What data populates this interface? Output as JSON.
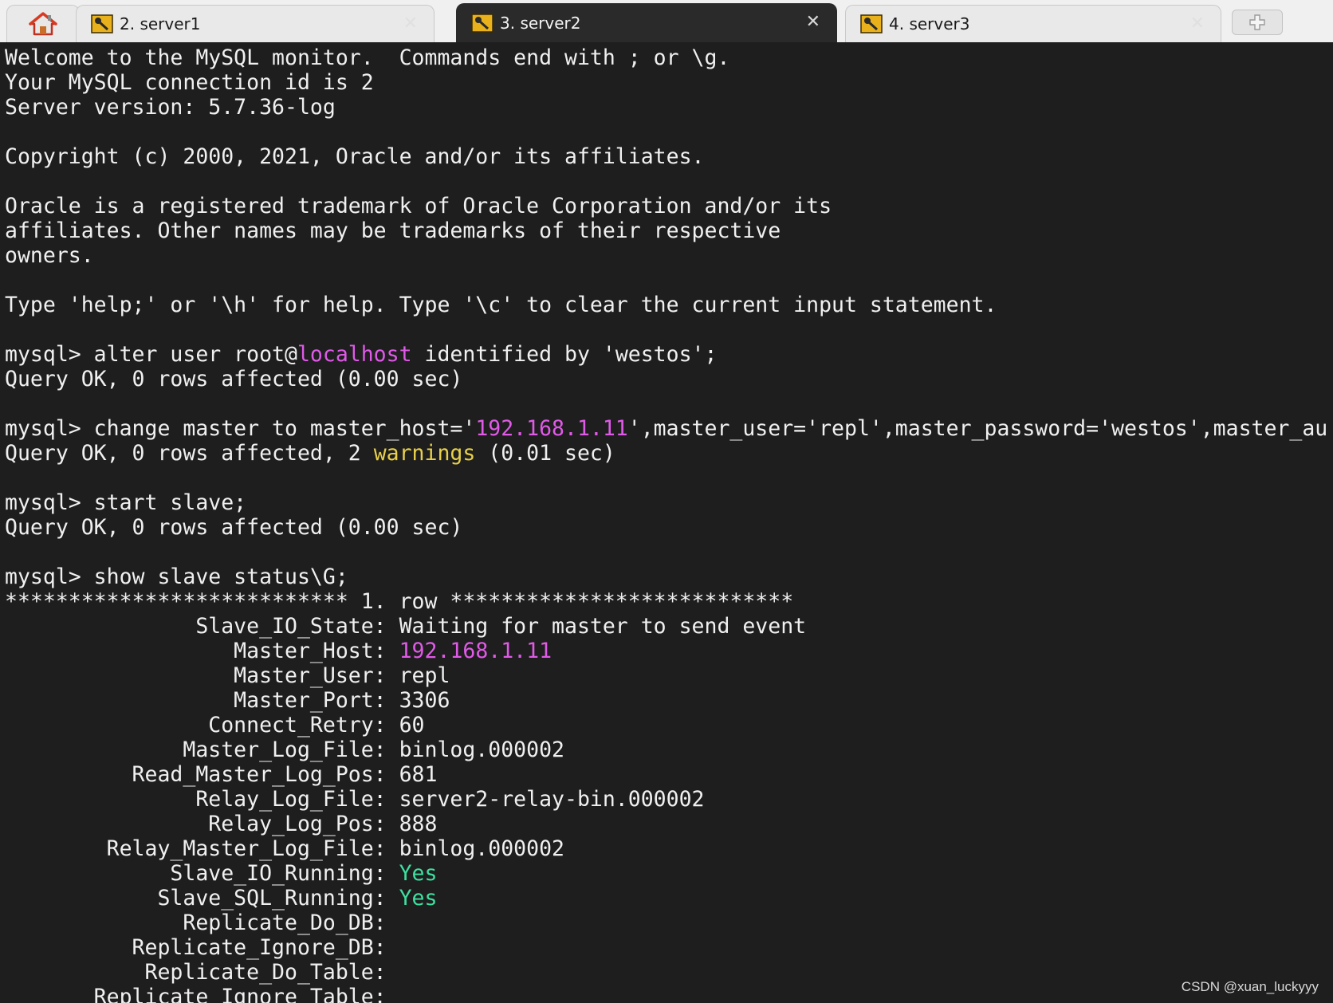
{
  "tabs": [
    {
      "label": "2. server1",
      "active": false
    },
    {
      "label": "3. server2",
      "active": true
    },
    {
      "label": "4. server3",
      "active": false
    }
  ],
  "terminal": {
    "lines": [
      [
        {
          "t": "Welcome to the MySQL monitor.  Commands end with ; or \\g."
        }
      ],
      [
        {
          "t": "Your MySQL connection id is 2"
        }
      ],
      [
        {
          "t": "Server version: 5.7.36-log"
        }
      ],
      [
        {
          "t": ""
        }
      ],
      [
        {
          "t": "Copyright (c) 2000, 2021, Oracle and/or its affiliates."
        }
      ],
      [
        {
          "t": ""
        }
      ],
      [
        {
          "t": "Oracle is a registered trademark of Oracle Corporation and/or its"
        }
      ],
      [
        {
          "t": "affiliates. Other names may be trademarks of their respective"
        }
      ],
      [
        {
          "t": "owners."
        }
      ],
      [
        {
          "t": ""
        }
      ],
      [
        {
          "t": "Type 'help;' or '\\h' for help. Type '\\c' to clear the current input statement."
        }
      ],
      [
        {
          "t": ""
        }
      ],
      [
        {
          "t": "mysql> alter user root@"
        },
        {
          "t": "localhost",
          "c": "magenta"
        },
        {
          "t": " identified by 'westos';"
        }
      ],
      [
        {
          "t": "Query OK, 0 rows affected (0.00 sec)"
        }
      ],
      [
        {
          "t": ""
        }
      ],
      [
        {
          "t": "mysql> change master to master_host='"
        },
        {
          "t": "192.168.1.11",
          "c": "magenta"
        },
        {
          "t": "',master_user='repl',master_password='westos',master_au"
        }
      ],
      [
        {
          "t": "Query OK, 0 rows affected, 2 "
        },
        {
          "t": "warnings",
          "c": "yellow"
        },
        {
          "t": " (0.01 sec)"
        }
      ],
      [
        {
          "t": ""
        }
      ],
      [
        {
          "t": "mysql> start slave;"
        }
      ],
      [
        {
          "t": "Query OK, 0 rows affected (0.00 sec)"
        }
      ],
      [
        {
          "t": ""
        }
      ],
      [
        {
          "t": "mysql> show slave status\\G;"
        }
      ],
      [
        {
          "t": "*************************** 1. row ***************************"
        }
      ],
      [
        {
          "t": "               Slave_IO_State: Waiting for master to send event"
        }
      ],
      [
        {
          "t": "                  Master_Host: "
        },
        {
          "t": "192.168.1.11",
          "c": "magenta"
        }
      ],
      [
        {
          "t": "                  Master_User: repl"
        }
      ],
      [
        {
          "t": "                  Master_Port: 3306"
        }
      ],
      [
        {
          "t": "                Connect_Retry: 60"
        }
      ],
      [
        {
          "t": "              Master_Log_File: binlog.000002"
        }
      ],
      [
        {
          "t": "          Read_Master_Log_Pos: 681"
        }
      ],
      [
        {
          "t": "               Relay_Log_File: server2-relay-bin.000002"
        }
      ],
      [
        {
          "t": "                Relay_Log_Pos: 888"
        }
      ],
      [
        {
          "t": "        Relay_Master_Log_File: binlog.000002"
        }
      ],
      [
        {
          "t": "             Slave_IO_Running: "
        },
        {
          "t": "Yes",
          "c": "green"
        }
      ],
      [
        {
          "t": "            Slave_SQL_Running: "
        },
        {
          "t": "Yes",
          "c": "green"
        }
      ],
      [
        {
          "t": "              Replicate_Do_DB:"
        }
      ],
      [
        {
          "t": "          Replicate_Ignore_DB:"
        }
      ],
      [
        {
          "t": "           Replicate_Do_Table:"
        }
      ],
      [
        {
          "t": "       Replicate_Ignore_Table:"
        }
      ]
    ]
  },
  "watermark": "CSDN @xuan_luckyyy",
  "colors": {
    "background": "#1e1e1e",
    "text": "#f0f0f0",
    "magenta": "#e05ae8",
    "yellow": "#e8d04a",
    "green": "#3ee0a0"
  },
  "icons": {
    "home": "home-icon",
    "tab": "key-icon",
    "close": "close-icon",
    "new_tab": "new-tab-icon"
  }
}
